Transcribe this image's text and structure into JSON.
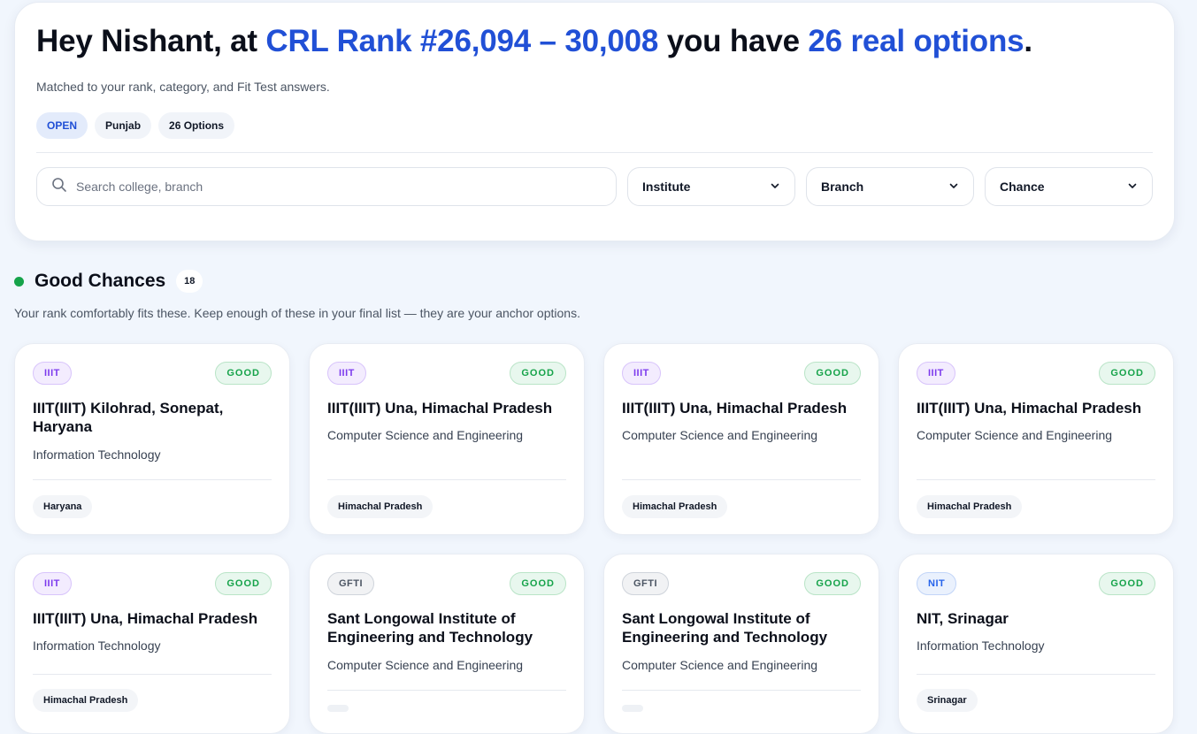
{
  "header": {
    "greeting_prefix": "Hey Nishant, at ",
    "rank_text": "CRL Rank #26,094 – 30,008",
    "greeting_mid": " you have ",
    "options_text": "26 real options",
    "greeting_suffix": ".",
    "subtitle": "Matched to your rank, category, and Fit Test answers.",
    "tags": [
      "OPEN",
      "Punjab",
      "26 Options"
    ]
  },
  "filters": {
    "search_placeholder": "Search college, branch",
    "search_value": "",
    "institute_label": "Institute",
    "branch_label": "Branch",
    "chance_label": "Chance"
  },
  "section": {
    "title": "Good Chances",
    "count": "18",
    "description": "Your rank comfortably fits these. Keep enough of these in your final list — they are your anchor options.",
    "indicator_color": "#16a34a"
  },
  "cards": [
    {
      "type": "IIIT",
      "chance": "GOOD",
      "title": "IIIT(IIIT) Kilohrad, Sonepat, Haryana",
      "branch": "Information Technology",
      "location": "Haryana"
    },
    {
      "type": "IIIT",
      "chance": "GOOD",
      "title": "IIIT(IIIT) Una, Himachal Pradesh",
      "branch": "Computer Science and Engineering",
      "location": "Himachal Pradesh"
    },
    {
      "type": "IIIT",
      "chance": "GOOD",
      "title": "IIIT(IIIT) Una, Himachal Pradesh",
      "branch": "Computer Science and Engineering",
      "location": "Himachal Pradesh"
    },
    {
      "type": "IIIT",
      "chance": "GOOD",
      "title": "IIIT(IIIT) Una, Himachal Pradesh",
      "branch": "Computer Science and Engineering",
      "location": "Himachal Pradesh"
    },
    {
      "type": "IIIT",
      "chance": "GOOD",
      "title": "IIIT(IIIT) Una, Himachal Pradesh",
      "branch": "Information Technology",
      "location": "Himachal Pradesh"
    },
    {
      "type": "GFTI",
      "chance": "GOOD",
      "title": "Sant Longowal Institute of Engineering and Technology",
      "branch": "Computer Science and Engineering",
      "location": ""
    },
    {
      "type": "GFTI",
      "chance": "GOOD",
      "title": "Sant Longowal Institute of Engineering and Technology",
      "branch": "Computer Science and Engineering",
      "location": ""
    },
    {
      "type": "NIT",
      "chance": "GOOD",
      "title": "NIT, Srinagar",
      "branch": "Information Technology",
      "location": "Srinagar"
    }
  ],
  "colors": {
    "accent_blue": "#2150d6",
    "good_green": "#16a34a",
    "iiit_purple": "#7c3aed",
    "nit_blue": "#2563eb",
    "page_background": "#f1f6fd"
  },
  "icons": {
    "search": "search-icon",
    "dropdown": "chevron-down-icon"
  }
}
